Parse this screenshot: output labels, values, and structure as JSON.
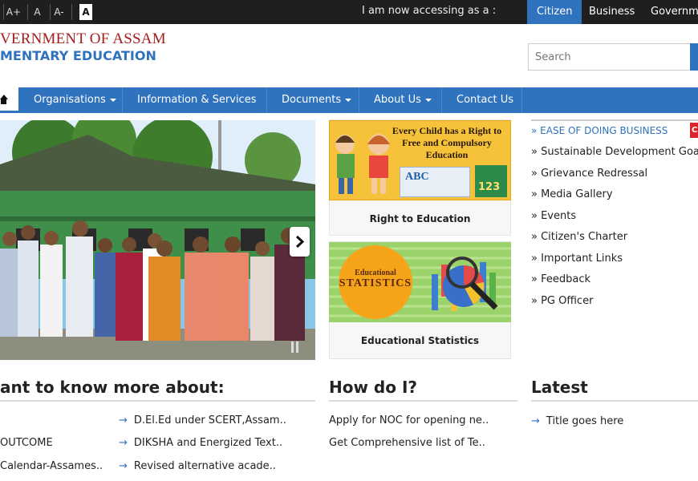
{
  "topbar": {
    "font_controls": [
      "A",
      "A+",
      "A",
      "A-",
      "A"
    ],
    "access_text": "I am now accessing as a :",
    "user_tabs": [
      {
        "label": "Citizen",
        "active": true
      },
      {
        "label": "Business",
        "active": false
      },
      {
        "label": "Governme",
        "active": false
      }
    ]
  },
  "header": {
    "org_line1": "VERNMENT OF ASSAM",
    "org_line2": "MENTARY EDUCATION",
    "search_placeholder": "Search"
  },
  "nav": {
    "home_icon": "home-icon",
    "items": [
      {
        "label": "Organisations",
        "dropdown": true
      },
      {
        "label": "Information & Services",
        "dropdown": true
      },
      {
        "label": "Documents",
        "dropdown": true
      },
      {
        "label": "About Us",
        "dropdown": true
      },
      {
        "label": "Contact Us",
        "dropdown": false
      }
    ]
  },
  "cards": [
    {
      "caption": "Right to Education",
      "image_text": [
        "Every Child has a Right to",
        "Free and Compulsory",
        "Education"
      ],
      "image_letters": "ABC",
      "image_numbers": "123"
    },
    {
      "caption": "Educational Statistics",
      "image_text": [
        "Educational",
        "STATISTICS"
      ]
    }
  ],
  "quick_links": [
    "» EASE OF DOING BUSINESS",
    "» Sustainable Development Goals",
    "» Grievance Redressal",
    "» Media Gallery",
    "» Events",
    "» Citizen's Charter",
    "» Important Links",
    "» Feedback",
    "» PG Officer"
  ],
  "quick_links_tag": "C",
  "sections": {
    "know_more": {
      "title": "ant to know more about:",
      "col1": [
        "OUTCOME",
        "Calendar-Assames.."
      ],
      "col2": [
        "D.El.Ed under SCERT,Assam..",
        "DIKSHA and Energized Text..",
        "Revised alternative acade.."
      ]
    },
    "how_do_i": {
      "title": "How do I?",
      "items": [
        "Apply for NOC for opening ne..",
        "Get Comprehensive list of Te.."
      ]
    },
    "latest": {
      "title": "Latest",
      "items": [
        "Title goes here"
      ]
    }
  },
  "colors": {
    "brand_blue": "#2f72bd",
    "org_red": "#a31d1d",
    "topbar_bg": "#1f1f1f",
    "tag_red": "#d9232d"
  }
}
